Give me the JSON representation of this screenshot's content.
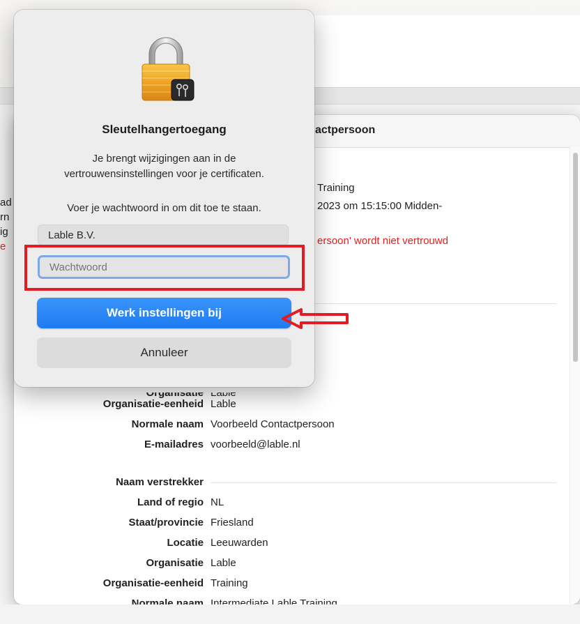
{
  "background": {
    "left_fragments": [
      "ad",
      "rn",
      "ig",
      "e"
    ]
  },
  "sheet": {
    "title": "actpersoon",
    "info_lines": [
      "Training",
      "2023 om 15:15:00 Midden-",
      "ersoon' wordt niet vertrouwd"
    ],
    "rows_a": [
      {
        "label": "Organisatie",
        "value": "Lable"
      },
      {
        "label": "Organisatie-eenheid",
        "value": "Lable"
      },
      {
        "label": "Normale naam",
        "value": "Voorbeeld Contactpersoon"
      },
      {
        "label": "E-mailadres",
        "value": "voorbeeld@lable.nl"
      }
    ],
    "issuer_heading": "Naam verstrekker",
    "rows_b": [
      {
        "label": "Land of regio",
        "value": "NL"
      },
      {
        "label": "Staat/provincie",
        "value": "Friesland"
      },
      {
        "label": "Locatie",
        "value": "Leeuwarden"
      },
      {
        "label": "Organisatie",
        "value": "Lable"
      },
      {
        "label": "Organisatie-eenheid",
        "value": "Training"
      },
      {
        "label": "Normale naam",
        "value": "Intermediate Lable Training"
      }
    ]
  },
  "dialog": {
    "icon": "keychain-lock-icon",
    "title": "Sleutelhangertoegang",
    "message_line1": "Je brengt wijzigingen aan in de",
    "message_line2": "vertrouwensinstellingen voor je certificaten.",
    "prompt": "Voer je wachtwoord in om dit toe te staan.",
    "username": "Lable B.V.",
    "password_value": "",
    "password_placeholder": "Wachtwoord",
    "primary_button": "Werk instellingen bij",
    "secondary_button": "Annuleer"
  },
  "colors": {
    "accent": "#1e7cf1",
    "annotation": "#e31b23",
    "warning_text": "#e0211d"
  }
}
